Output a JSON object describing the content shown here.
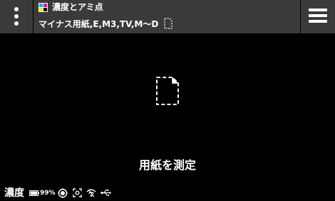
{
  "header": {
    "title": "濃度とアミ点",
    "subtitle": "マイナス用紙,E,M3,TV,M～D",
    "menu_icon": "kebab-menu-icon",
    "expand_icon": "chevron-down-icon",
    "hamburger_icon": "hamburger-menu-icon",
    "mode_icon_colors": [
      "#00b7eb",
      "#ff00a0",
      "#ffe600",
      "#000000"
    ]
  },
  "main": {
    "icon": "paper-icon",
    "status_text": "用紙を測定"
  },
  "statusbar": {
    "mode_label": "濃度",
    "battery_text": "99%",
    "battery_level": 0.99,
    "icons": [
      "battery-icon",
      "target-icon",
      "capture-icon",
      "wifi-icon",
      "usb-icon"
    ]
  }
}
